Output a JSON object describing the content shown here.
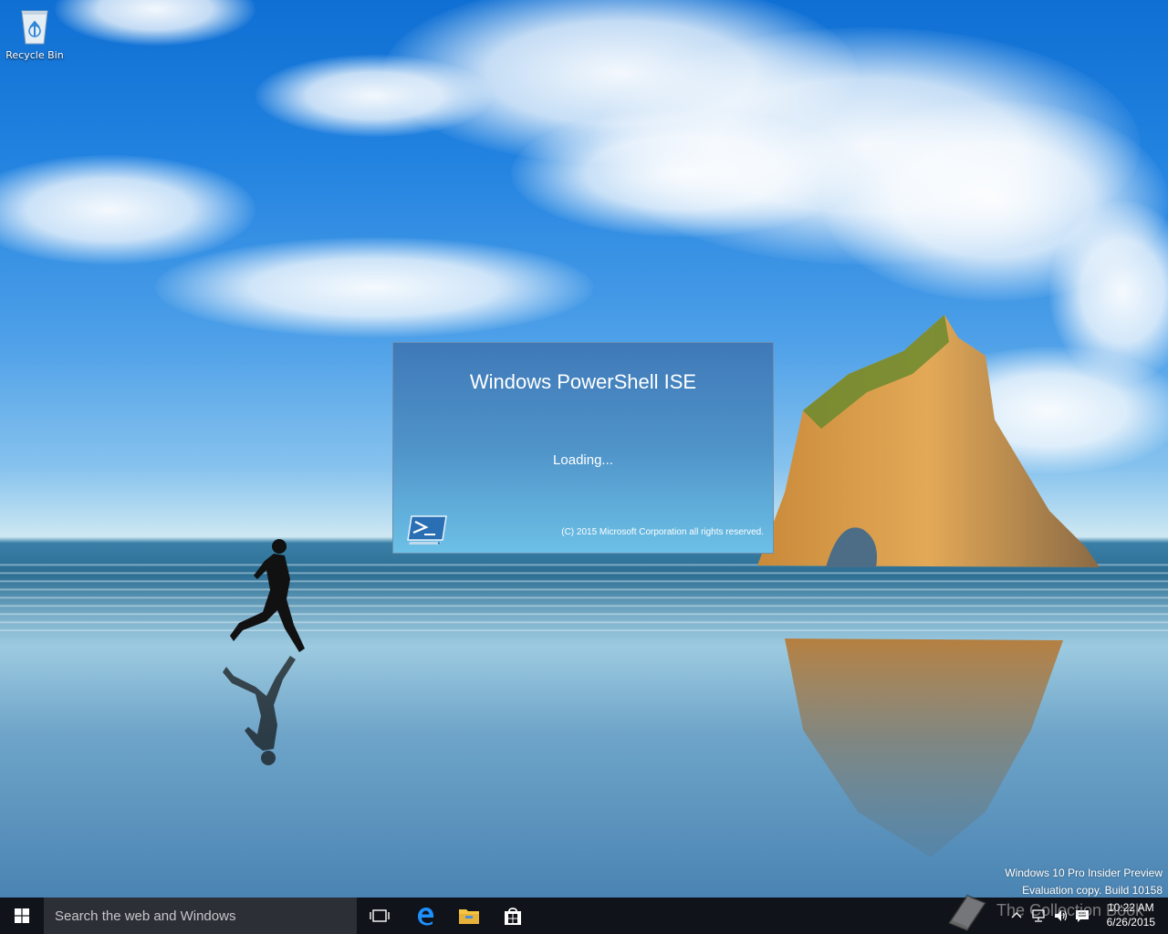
{
  "desktop": {
    "icons": [
      {
        "label": "Recycle Bin",
        "icon": "recycle-bin-icon"
      }
    ]
  },
  "splash": {
    "title": "Windows PowerShell ISE",
    "status": "Loading...",
    "copyright": "(C) 2015 Microsoft Corporation all rights reserved.",
    "icon": "powershell-icon"
  },
  "watermark": {
    "line1": "Windows 10 Pro Insider Preview",
    "line2": "Evaluation copy. Build 10158"
  },
  "overlay": {
    "text": "The Collection Book",
    "icon": "book-icon"
  },
  "taskbar": {
    "start_icon": "windows-logo-icon",
    "search_placeholder": "Search the web and Windows",
    "pinned": [
      {
        "name": "Task View",
        "icon": "task-view-icon"
      },
      {
        "name": "Microsoft Edge",
        "icon": "edge-icon"
      },
      {
        "name": "File Explorer",
        "icon": "folder-icon"
      },
      {
        "name": "Store",
        "icon": "store-icon"
      }
    ],
    "tray": {
      "icons": [
        "chevron-up-icon",
        "network-icon",
        "volume-icon",
        "action-center-icon"
      ],
      "time": "10:22 AM",
      "date": "6/26/2015"
    }
  },
  "colors": {
    "taskbar_bg": "#101319",
    "search_bg": "#2c2f36",
    "splash_top": "#3f79b8",
    "splash_bottom": "#6cc0e6",
    "edge_blue": "#1e90ff",
    "folder_yellow": "#f5c542"
  }
}
